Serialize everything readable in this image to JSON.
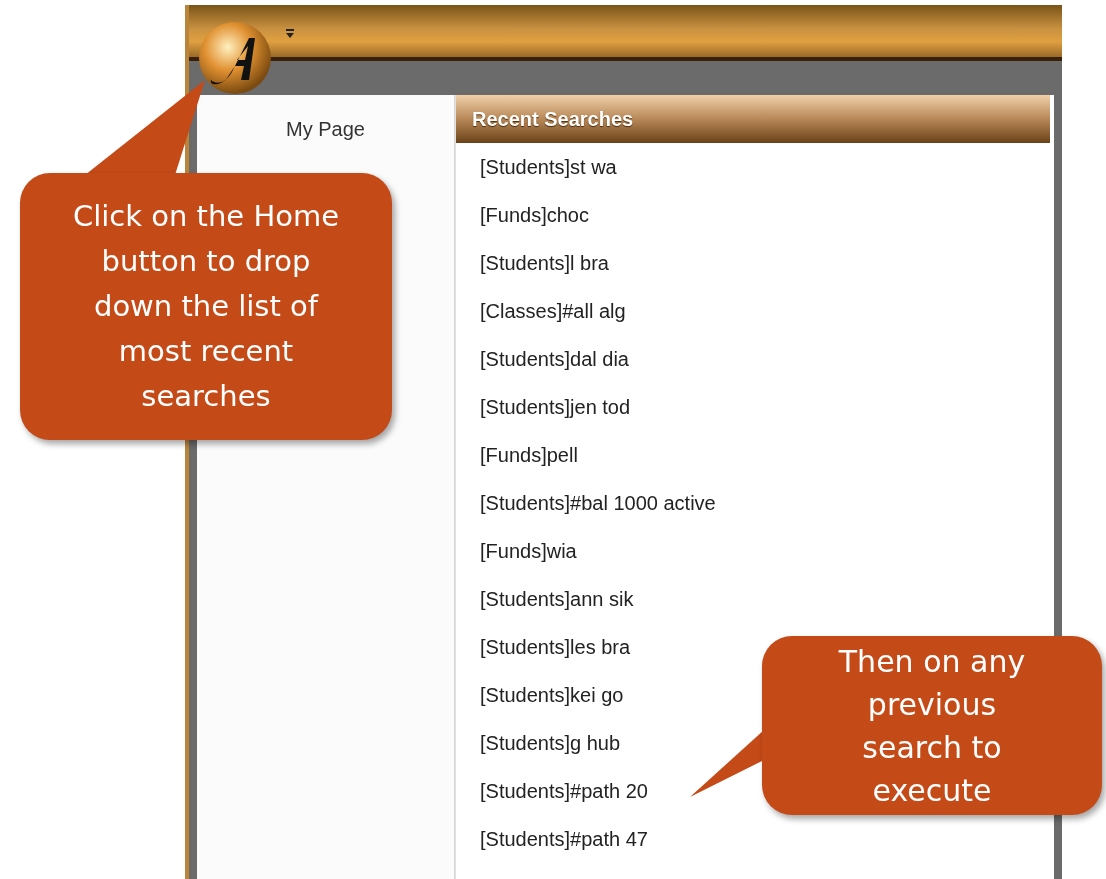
{
  "left_menu": {
    "items": [
      {
        "label": "My Page"
      }
    ]
  },
  "recent_searches": {
    "title": "Recent Searches",
    "items": [
      "[Students]st wa",
      "[Funds]choc",
      "[Students]l bra",
      "[Classes]#all alg",
      "[Students]dal dia",
      "[Students]jen tod",
      "[Funds]pell",
      "[Students]#bal 1000 active",
      "[Funds]wia",
      "[Students]ann sik",
      "[Students]les bra",
      "[Students]kei go",
      "[Students]g hub",
      "[Students]#path 20",
      "[Students]#path 47"
    ]
  },
  "callouts": [
    {
      "text": "Click on the Home button to drop down the list of most recent searches"
    },
    {
      "text": "Then on any previous search to execute"
    }
  ]
}
